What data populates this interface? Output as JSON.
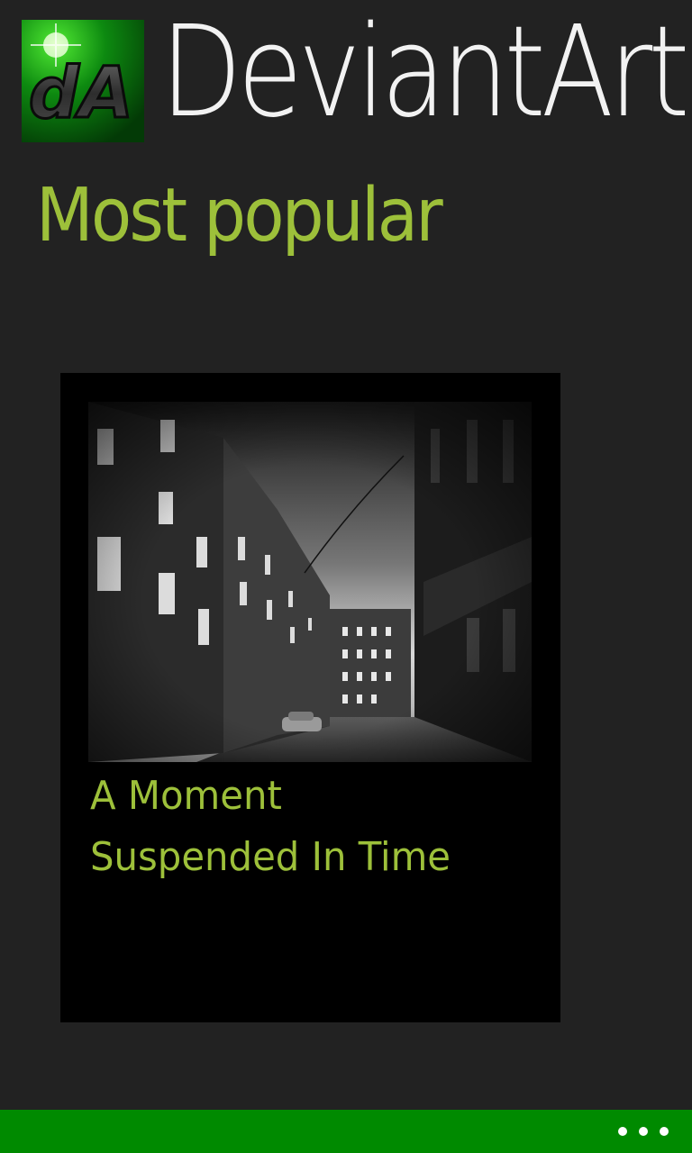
{
  "header": {
    "logo_text": "dA",
    "logo_icon": "deviantart-logo-icon",
    "app_title": "DeviantArt"
  },
  "section": {
    "title": "Most popular"
  },
  "tiles": [
    {
      "image_icon": "dark-alley-photo",
      "caption": "A Moment Suspended In Time"
    }
  ],
  "app_bar": {
    "more_icon": "ellipsis-icon"
  },
  "colors": {
    "background": "#222222",
    "accent": "#9dc03a",
    "app_bar": "#008a00",
    "tile_background": "#000000"
  }
}
